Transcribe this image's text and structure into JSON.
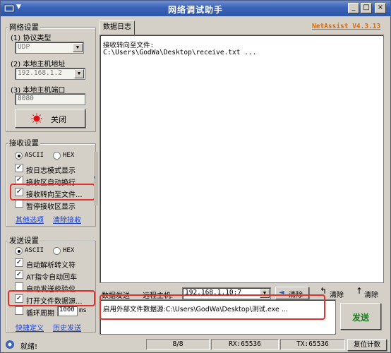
{
  "window": {
    "title": "网络调试助手"
  },
  "brand": {
    "label": "NetAssist V4.3.13"
  },
  "net_settings": {
    "group_title": "网络设置",
    "protocol_label": "(1) 协议类型",
    "protocol_value": "UDP",
    "local_host_label": "(2) 本地主机地址",
    "local_host_value": "192.168.1.2",
    "local_port_label": "(3) 本地主机端口",
    "local_port_value": "8080",
    "close_button": "关闭"
  },
  "receive_settings": {
    "group_title": "接收设置",
    "ascii": "ASCII",
    "hex": "HEX",
    "options": [
      {
        "label": "按日志模式显示",
        "checked": true
      },
      {
        "label": "接收区自动换行",
        "checked": true
      },
      {
        "label": "接收转向至文件...",
        "checked": true
      },
      {
        "label": "暂停接收区显示",
        "checked": false
      }
    ],
    "links": [
      "其他选项",
      "清除接收"
    ]
  },
  "send_settings": {
    "group_title": "发送设置",
    "ascii": "ASCII",
    "hex": "HEX",
    "options": [
      {
        "label": "自动解析转义符",
        "checked": true
      },
      {
        "label": "AT指令自动回车",
        "checked": true
      },
      {
        "label": "自动发送校验位",
        "checked": false
      },
      {
        "label": "打开文件数据源...",
        "checked": true
      }
    ],
    "loop_label": "循环周期",
    "loop_value": "1000",
    "loop_unit": "ms",
    "links": [
      "快捷定义",
      "历史发送"
    ]
  },
  "log": {
    "tab_label": "数据日志",
    "lines": [
      "接收转向至文件:",
      "C:\\Users\\GodWa\\Desktop\\receive.txt ..."
    ]
  },
  "send_bar": {
    "send_label": "数据发送",
    "remote_label": "远程主机:",
    "remote_value": "192.168.1.10:7",
    "clear_button": "清除",
    "clear2": "清除",
    "clear3": "清除",
    "send_text": "启用外部文件数据源:C:\\Users\\GodWa\\Desktop\\测试.exe ...",
    "send_button": "发送"
  },
  "status": {
    "ready": "就绪!",
    "counter": "8/8",
    "rx": "RX:65536",
    "tx": "TX:65536",
    "reset": "复位计数"
  },
  "colors": {
    "title_bar": "#3a63b8",
    "highlight_box": "#e0322c",
    "brand": "#e06a00",
    "link": "#1a3fd0"
  }
}
